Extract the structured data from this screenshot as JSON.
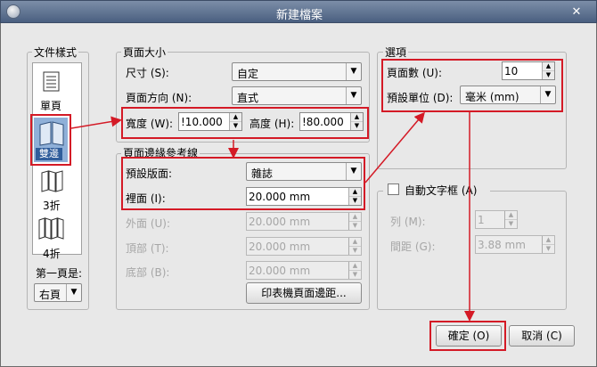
{
  "window": {
    "title": "新建檔案",
    "close": "✕"
  },
  "doc_style": {
    "legend": "文件樣式",
    "options": [
      {
        "label": "單頁"
      },
      {
        "label": "雙邊"
      },
      {
        "label": "3折"
      },
      {
        "label": "4折"
      }
    ],
    "first_page_label": "第一頁是:",
    "first_page_value": "右頁"
  },
  "page_size": {
    "legend": "頁面大小",
    "size_label": "尺寸 (S):",
    "size_value": "自定",
    "orientation_label": "頁面方向 (N):",
    "orientation_value": "直式",
    "width_label": "寬度 (W):",
    "width_value": "!10.000",
    "height_label": "高度 (H):",
    "height_value": "!80.000"
  },
  "margins": {
    "legend": "頁面邊緣參考線",
    "preset_label": "預設版面:",
    "preset_value": "雜誌",
    "inside_label": "裡面 (I):",
    "inside_value": "20.000 mm",
    "outside_label": "外面 (U):",
    "outside_value": "20.000 mm",
    "top_label": "頂部 (T):",
    "top_value": "20.000 mm",
    "bottom_label": "底部 (B):",
    "bottom_value": "20.000 mm",
    "printer_button": "印表機頁面邊距..."
  },
  "options": {
    "legend": "選項",
    "pages_label": "頁面數 (U):",
    "pages_value": "10",
    "unit_label": "預設單位 (D):",
    "unit_value": "毫米 (mm)"
  },
  "auto_frame": {
    "label": "自動文字框 (A)",
    "columns_label": "列 (M):",
    "columns_value": "1",
    "gap_label": "間距 (G):",
    "gap_value": "3.88 mm"
  },
  "buttons": {
    "ok": "確定 (O)",
    "cancel": "取消 (C)"
  },
  "colors": {
    "annotation": "#d41a26",
    "titlebar": "#5a6d8c"
  }
}
